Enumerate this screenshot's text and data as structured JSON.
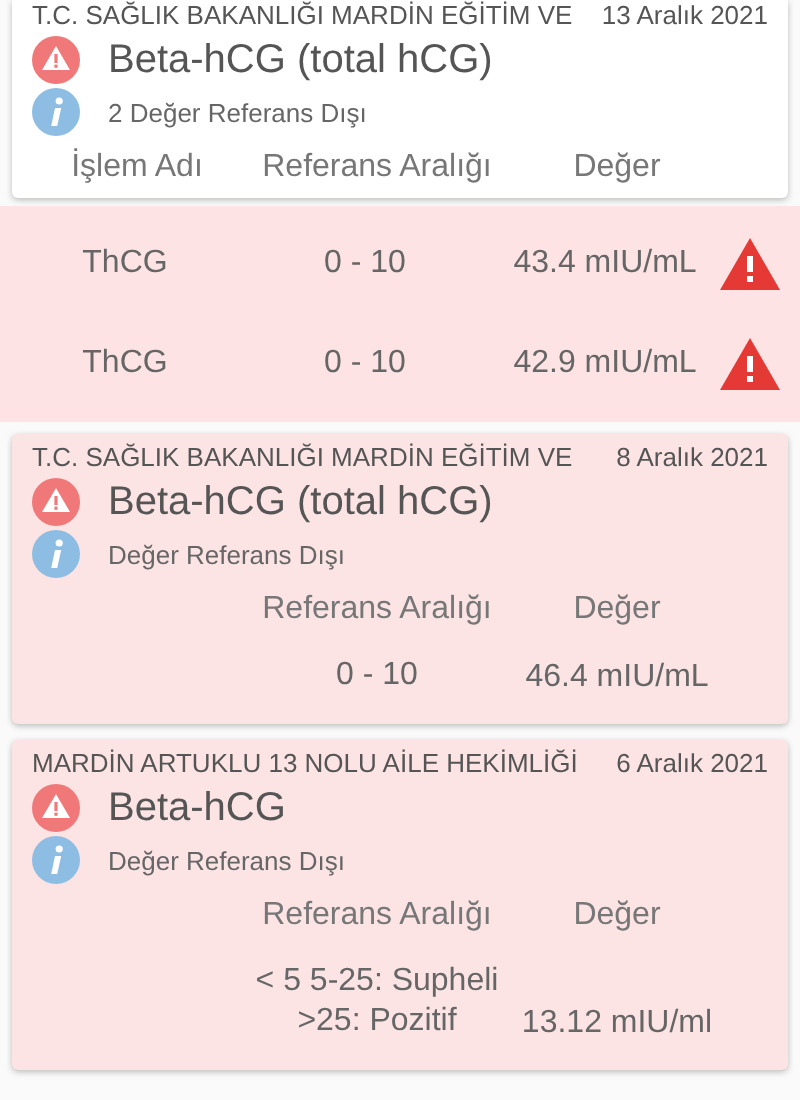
{
  "results": [
    {
      "institution": "T.C. SAĞLIK BAKANLIĞI MARDİN EĞİTİM VE",
      "date": "13 Aralık 2021",
      "test": "Beta-hCG (total hCG)",
      "note": "2 Değer Referans Dışı",
      "expanded": true,
      "headers": {
        "name": "İşlem Adı",
        "range": "Referans Aralığı",
        "value": "Değer"
      },
      "rows": [
        {
          "name": "ThCG",
          "range": "0 - 10",
          "value": "43.4 mIU/mL",
          "flagged": true
        },
        {
          "name": "ThCG",
          "range": "0 - 10",
          "value": "42.9 mIU/mL",
          "flagged": true
        }
      ]
    },
    {
      "institution": "T.C. SAĞLIK BAKANLIĞI MARDİN EĞİTİM VE",
      "date": "8 Aralık 2021",
      "test": "Beta-hCG (total hCG)",
      "note": "Değer Referans Dışı",
      "expanded": false,
      "headers": {
        "range": "Referans Aralığı",
        "value": "Değer"
      },
      "rows": [
        {
          "range": "0 - 10",
          "value": "46.4 mIU/mL",
          "flagged": false
        }
      ]
    },
    {
      "institution": "MARDİN ARTUKLU 13 NOLU AİLE HEKİMLİĞİ",
      "date": "6 Aralık 2021",
      "test": "Beta-hCG",
      "note": "Değer Referans Dışı",
      "expanded": false,
      "headers": {
        "range": "Referans Aralığı",
        "value": "Değer"
      },
      "rows": [
        {
          "range": "< 5 5-25: Supheli\n>25: Pozitif",
          "value": "13.12 mIU/ml",
          "flagged": false
        }
      ]
    }
  ]
}
